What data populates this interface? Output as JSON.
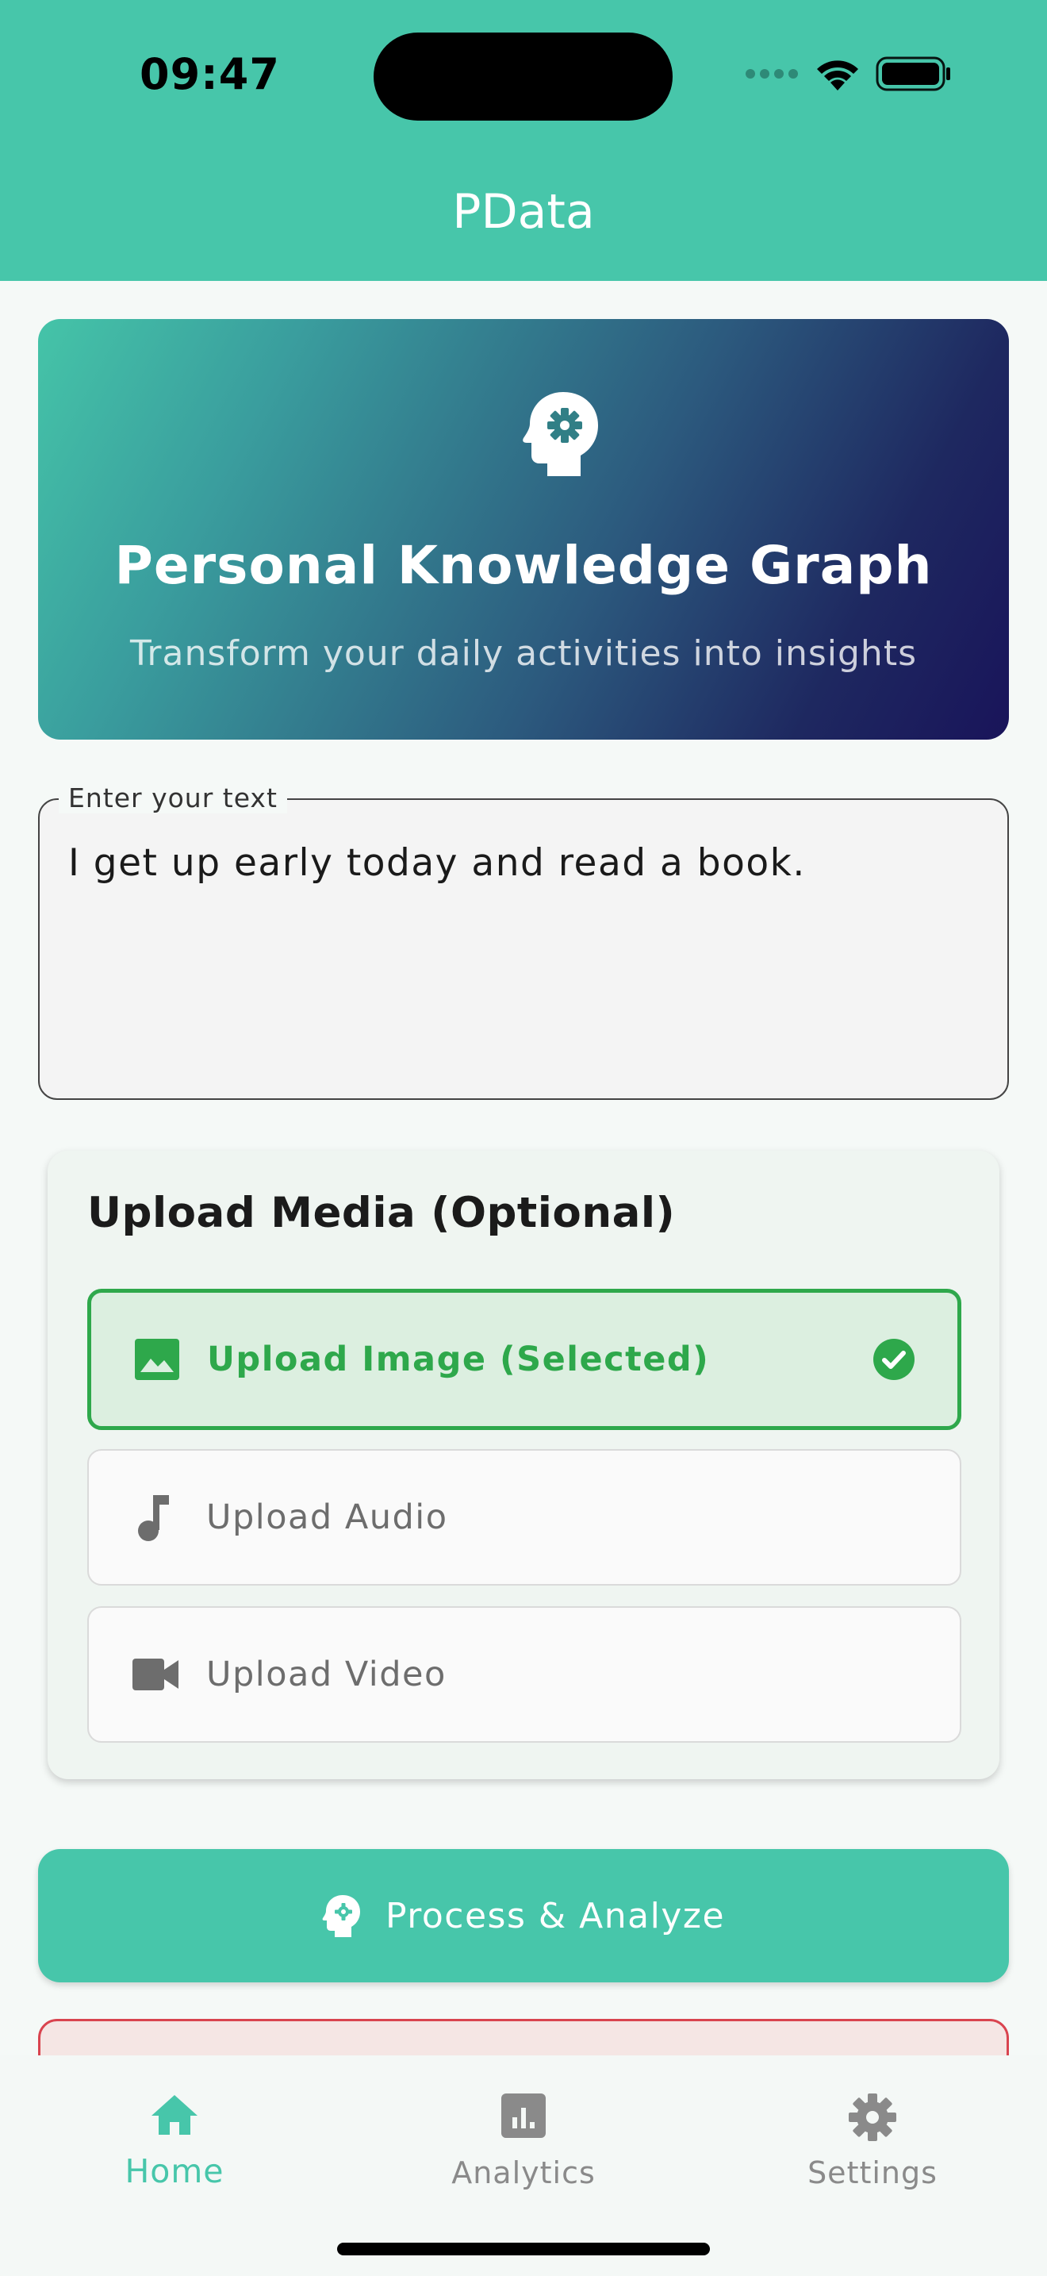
{
  "status_bar": {
    "time": "09:47"
  },
  "app_bar": {
    "title": "PData"
  },
  "hero": {
    "icon": "head-gear-icon",
    "title": "Personal Knowledge Graph",
    "subtitle": "Transform your daily activities into insights"
  },
  "text_input": {
    "label": "Enter your text",
    "value": "I get up early today and read a book."
  },
  "upload_media": {
    "title": "Upload Media (Optional)",
    "options": [
      {
        "label": "Upload Image (Selected)",
        "icon": "image-icon",
        "selected": true
      },
      {
        "label": "Upload Audio",
        "icon": "music-note-icon",
        "selected": false
      },
      {
        "label": "Upload Video",
        "icon": "videocam-icon",
        "selected": false
      }
    ]
  },
  "process_button": {
    "label": "Process & Analyze",
    "icon": "head-gear-icon"
  },
  "bottom_nav": {
    "items": [
      {
        "label": "Home",
        "icon": "home-icon",
        "active": true
      },
      {
        "label": "Analytics",
        "icon": "analytics-icon",
        "active": false
      },
      {
        "label": "Settings",
        "icon": "settings-icon",
        "active": false
      }
    ]
  },
  "colors": {
    "primary": "#47c6aa",
    "selected_green": "#2ea84b",
    "hero_gradient_end": "#19145a",
    "error_border": "#d9444f"
  }
}
